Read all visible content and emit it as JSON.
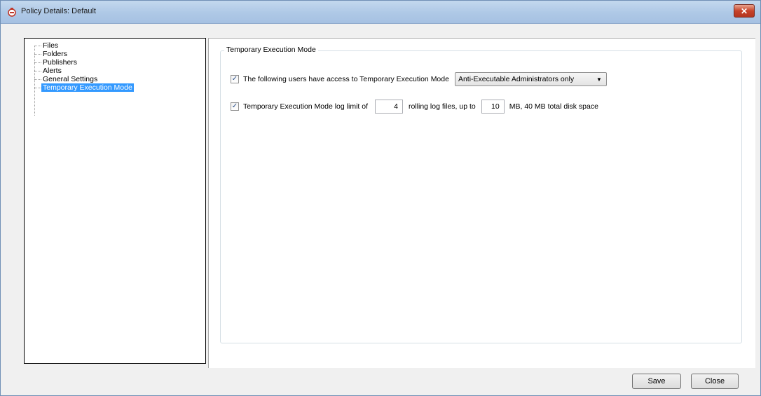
{
  "window": {
    "title": "Policy Details: Default",
    "close_glyph": "✕"
  },
  "tree": {
    "items": [
      {
        "label": "Files"
      },
      {
        "label": "Folders"
      },
      {
        "label": "Publishers"
      },
      {
        "label": "Alerts"
      },
      {
        "label": "General Settings"
      },
      {
        "label": "Temporary Execution Mode",
        "selected": true
      }
    ],
    "selection_color": "#3399ff"
  },
  "group": {
    "legend": "Temporary Execution Mode",
    "access": {
      "checked": true,
      "label": "The following users have access to Temporary Execution Mode",
      "select_value": "Anti-Executable Administrators only"
    },
    "log": {
      "checked": true,
      "label_prefix": "Temporary Execution Mode log limit of",
      "files_value": "4",
      "label_middle": "rolling log files, up to",
      "size_value": "10",
      "label_suffix": "MB, 40 MB total disk space"
    }
  },
  "buttons": {
    "save": "Save",
    "close": "Close"
  },
  "icons": {
    "app": "policy-app-icon",
    "check": "✓",
    "dropdown": "▼"
  }
}
